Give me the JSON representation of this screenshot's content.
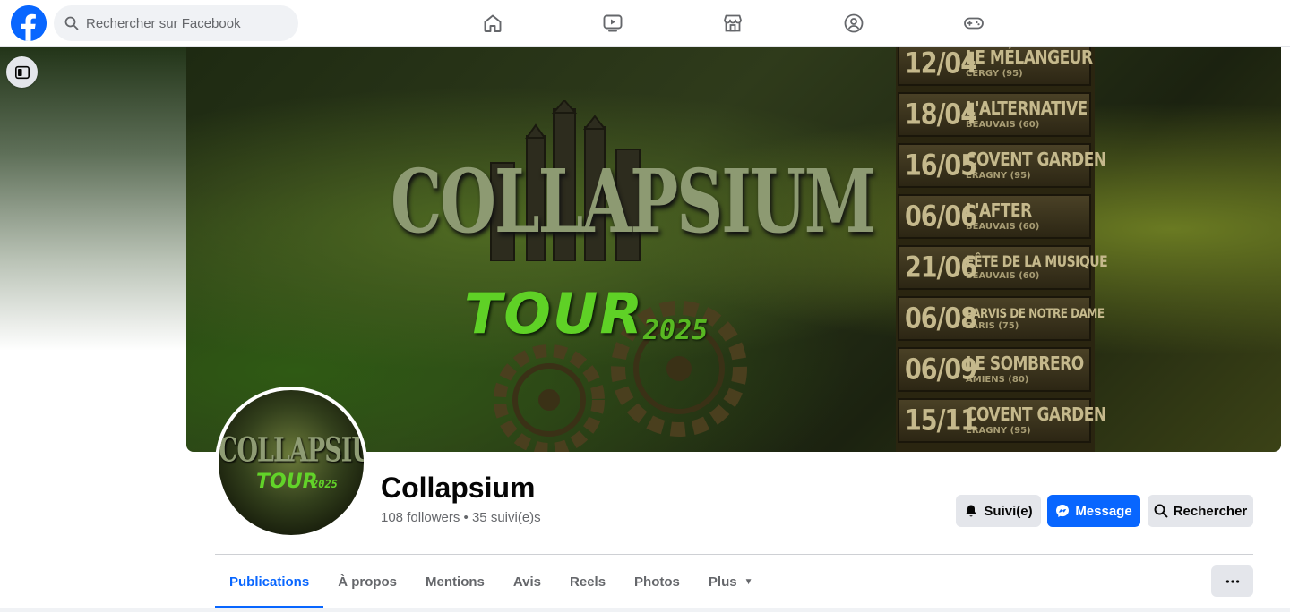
{
  "topbar": {
    "search_placeholder": "Rechercher sur Facebook",
    "nav_icons": [
      "home-icon",
      "video-icon",
      "marketplace-icon",
      "groups-icon",
      "gaming-icon"
    ]
  },
  "cover": {
    "title": "COLLAPSIUM",
    "subtitle": "TOUR",
    "year": "2025",
    "dates": [
      {
        "date": "12/04",
        "venue": "LE MÉLANGEUR",
        "city": "CERGY (95)"
      },
      {
        "date": "18/04",
        "venue": "L'ALTERNATIVE",
        "city": "BEAUVAIS (60)"
      },
      {
        "date": "16/05",
        "venue": "COVENT GARDEN",
        "city": "ERAGNY (95)"
      },
      {
        "date": "06/06",
        "venue": "L'AFTER",
        "city": "BEAUVAIS (60)"
      },
      {
        "date": "21/06",
        "venue": "FÊTE DE LA MUSIQUE",
        "city": "BEAUVAIS (60)"
      },
      {
        "date": "06/08",
        "venue": "PARVIS DE NOTRE DAME",
        "city": "PARIS (75)"
      },
      {
        "date": "06/09",
        "venue": "LE SOMBRERO",
        "city": "AMIENS (80)"
      },
      {
        "date": "15/11",
        "venue": "COVENT GARDEN",
        "city": "ERAGNY (95)"
      }
    ]
  },
  "avatar": {
    "title": "COLLAPSIUM",
    "subtitle": "TOUR",
    "year": "2025"
  },
  "profile": {
    "name": "Collapsium",
    "stats": "108 followers • 35 suivi(e)s"
  },
  "actions": {
    "follow_label": "Suivi(e)",
    "message_label": "Message",
    "search_label": "Rechercher"
  },
  "tabs": [
    {
      "label": "Publications",
      "active": true
    },
    {
      "label": "À propos"
    },
    {
      "label": "Mentions"
    },
    {
      "label": "Avis"
    },
    {
      "label": "Reels"
    },
    {
      "label": "Photos"
    },
    {
      "label": "Plus"
    }
  ],
  "colors": {
    "brand": "#0866ff",
    "button_grey": "#e4e6eb",
    "secondary_text": "#65676b"
  }
}
